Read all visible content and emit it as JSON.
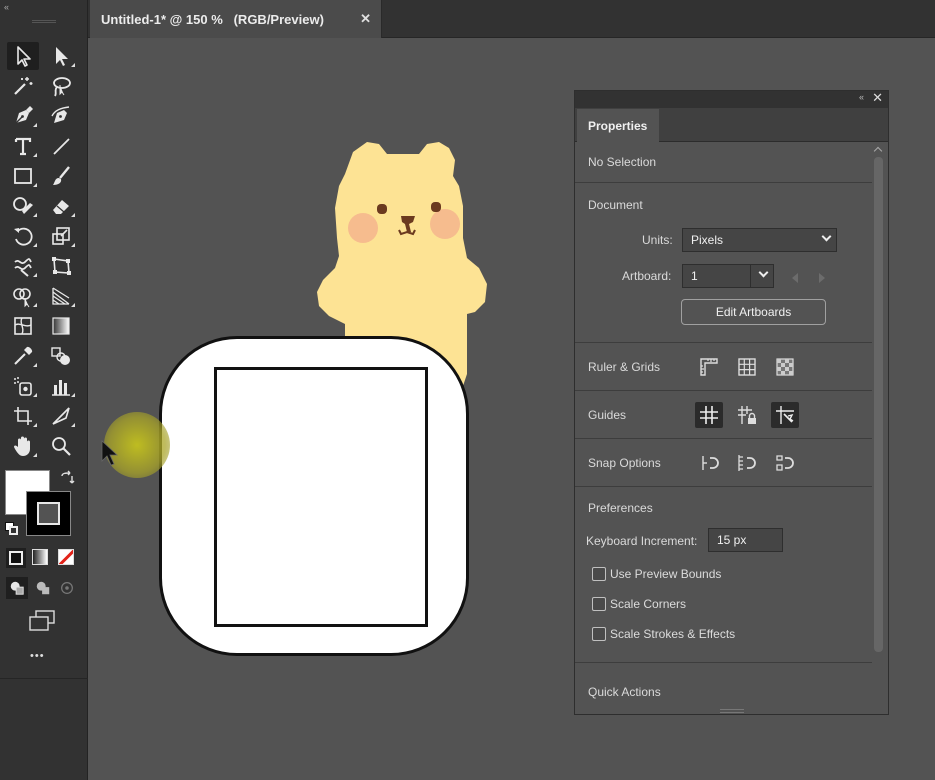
{
  "document_tab": {
    "title": "Untitled-1* @ 150 %   (RGB/Preview)",
    "close_glyph": "✕"
  },
  "toolbar": {
    "collapse_glyph": "«",
    "more_glyph": "•••",
    "tools": [
      "selection-tool",
      "direct-selection-tool",
      "magic-wand-tool",
      "lasso-tool",
      "pen-tool",
      "curvature-tool",
      "type-tool",
      "line-segment-tool",
      "rectangle-tool",
      "paintbrush-tool",
      "shaper-tool",
      "eraser-tool",
      "rotate-tool",
      "scale-tool",
      "warp-tool",
      "free-transform-tool",
      "shape-builder-tool",
      "perspective-grid-tool",
      "mesh-tool",
      "gradient-tool",
      "eyedropper-tool",
      "blend-tool",
      "symbol-sprayer-tool",
      "column-graph-tool",
      "artboard-tool",
      "slice-tool",
      "hand-tool",
      "zoom-tool"
    ],
    "fill_color": "#ffffff",
    "stroke_color": "#000000"
  },
  "properties_panel": {
    "tab_label": "Properties",
    "collapse_glyph": "«",
    "close_glyph": "✕",
    "selection_state": "No Selection",
    "document": {
      "heading": "Document",
      "units_label": "Units:",
      "units_value": "Pixels",
      "artboard_label": "Artboard:",
      "artboard_value": "1",
      "edit_artboards_label": "Edit Artboards"
    },
    "ruler_grids_label": "Ruler & Grids",
    "guides_label": "Guides",
    "snap_options_label": "Snap Options",
    "preferences": {
      "heading": "Preferences",
      "keyboard_increment_label": "Keyboard Increment:",
      "keyboard_increment_value": "15 px",
      "checkboxes": [
        {
          "label": "Use Preview Bounds",
          "checked": false
        },
        {
          "label": "Scale Corners",
          "checked": false
        },
        {
          "label": "Scale Strokes & Effects",
          "checked": false
        }
      ]
    },
    "quick_actions_label": "Quick Actions"
  },
  "colors": {
    "app_bg": "#535353",
    "panel_bg": "#323232",
    "bear_fill": "#fde394",
    "bear_cheek": "#f6bc8e",
    "bear_features": "#6b3a1f",
    "cursor_halo": "#c4c21e"
  }
}
